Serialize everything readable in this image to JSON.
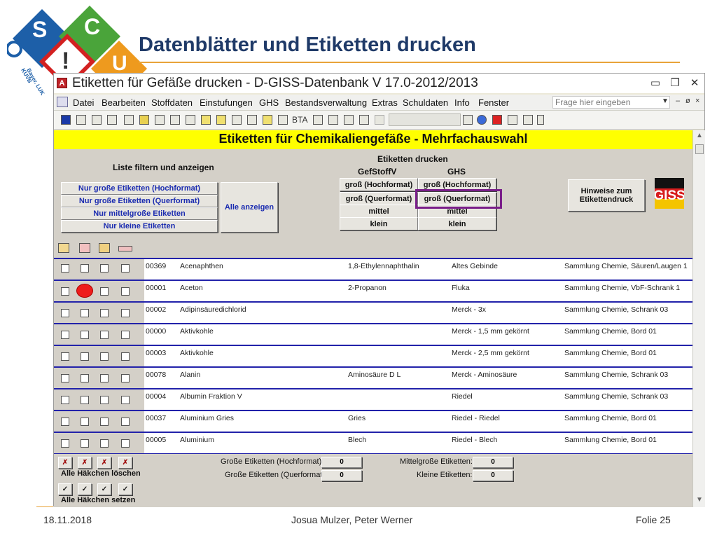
{
  "slide": {
    "title": "Datenblätter und Etiketten drucken",
    "logo_letters": {
      "s": "S",
      "c": "C",
      "u": "U",
      "excl": "!"
    },
    "logo_text": [
      "KUVB",
      "Bayer. LUK"
    ],
    "footer": {
      "date": "18.11.2018",
      "authors": "Josua Mulzer, Peter Werner",
      "page": "Folie 25"
    }
  },
  "window": {
    "app_icon": "A",
    "title": "Etiketten für Gefäße drucken - D-GISS-Datenbank V 17.0-2012/2013",
    "controls": [
      "▭",
      "❐",
      "✕"
    ]
  },
  "menu": {
    "items": [
      "Datei",
      "Bearbeiten",
      "Stoffdaten",
      "Einstufungen",
      "GHS",
      "Bestandsverwaltung",
      "Extras",
      "Schuldaten",
      "Info",
      "Fenster"
    ],
    "help_placeholder": "Frage hier eingeben",
    "controls": [
      "–",
      "ø",
      "×"
    ]
  },
  "toolbar": {
    "bta_label": "BTA"
  },
  "form": {
    "header": "Etiketten für Chemikaliengefäße - Mehrfachauswahl",
    "filter_label": "Liste filtern und anzeigen",
    "filter_buttons": [
      "Nur große Etiketten (Hochformat)",
      "Nur große Etiketten (Querformat)",
      "Nur mittelgroße Etiketten",
      "Nur kleine Etiketten"
    ],
    "show_all": "Alle anzeigen",
    "print_label": "Etiketten drucken",
    "col_gefstoffv": "GefStoffV",
    "col_ghs": "GHS",
    "gef_buttons": [
      "groß (Hochformat)",
      "groß (Querformat)",
      "mittel",
      "klein"
    ],
    "ghs_buttons": [
      "groß (Hochformat)",
      "groß (Querformat)",
      "mittel",
      "klein"
    ],
    "hint_button": "Hinweise zum Etikettendruck",
    "giss_logo": "GISS"
  },
  "rows": [
    {
      "id": "00369",
      "name": "Acenaphthen",
      "synonym": "1,8-Ethylennaphthalin",
      "supplier": "Altes Gebinde",
      "location": "Sammlung Chemie, Säuren/Laugen 1"
    },
    {
      "id": "00001",
      "name": "Aceton",
      "synonym": "2-Propanon",
      "supplier": "Fluka",
      "location": "Sammlung Chemie, VbF-Schrank 1"
    },
    {
      "id": "00002",
      "name": "Adipinsäuredichlorid",
      "synonym": "",
      "supplier": "Merck - 3x",
      "location": "Sammlung Chemie, Schrank 03"
    },
    {
      "id": "00000",
      "name": "Aktivkohle",
      "synonym": "",
      "supplier": "Merck - 1,5 mm gekörnt",
      "location": "Sammlung Chemie, Bord 01"
    },
    {
      "id": "00003",
      "name": "Aktivkohle",
      "synonym": "",
      "supplier": "Merck - 2,5 mm gekörnt",
      "location": "Sammlung Chemie, Bord 01"
    },
    {
      "id": "00078",
      "name": "Alanin",
      "synonym": "Aminosäure D L",
      "supplier": "Merck - Aminosäure",
      "location": "Sammlung Chemie, Schrank 03"
    },
    {
      "id": "00004",
      "name": "Albumin Fraktion V",
      "synonym": "",
      "supplier": "Riedel",
      "location": "Sammlung Chemie, Schrank 03"
    },
    {
      "id": "00037",
      "name": "Aluminium Gries",
      "synonym": "Gries",
      "supplier": "Riedel - Riedel",
      "location": "Sammlung Chemie, Bord 01"
    },
    {
      "id": "00005",
      "name": "Aluminium",
      "synonym": "Blech",
      "supplier": "Riedel - Blech",
      "location": "Sammlung Chemie, Bord 01"
    }
  ],
  "bottom": {
    "clear_label": "Alle Häkchen löschen",
    "set_label": "Alle Häkchen setzen",
    "clear_icon": "✗",
    "check_icon": "✓",
    "counts": [
      {
        "label": "Große Etiketten (Hochformat):",
        "value": "0"
      },
      {
        "label": "Große Etiketten (Querformat):",
        "value": "0"
      },
      {
        "label": "Mittelgroße Etiketten:",
        "value": "0"
      },
      {
        "label": "Kleine Etiketten:",
        "value": "0"
      }
    ]
  },
  "colors": {
    "accent": "#e8a33a",
    "title": "#1f3a68",
    "highlight": "#7a1e8a",
    "yellow": "#ffff00",
    "row_line": "#2222aa"
  }
}
